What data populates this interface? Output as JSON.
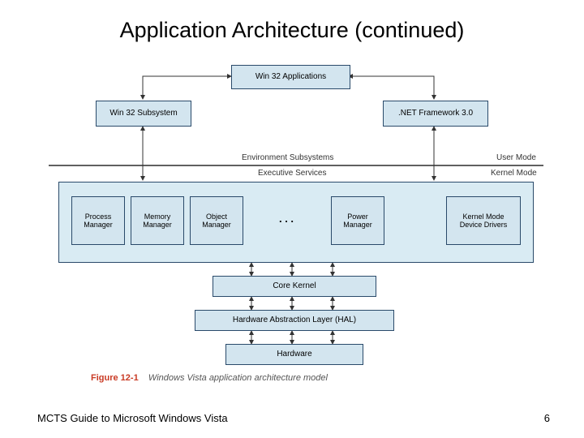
{
  "title": "Application Architecture (continued)",
  "boxes": {
    "win32_apps": "Win 32 Applications",
    "win32_sub": "Win 32 Subsystem",
    "netfx": ".NET Framework 3.0",
    "env_sub": "Environment Subsystems",
    "user_mode": "User Mode",
    "exec_svc": "Executive Services",
    "kernel_mode": "Kernel Mode",
    "proc_mgr": "Process\nManager",
    "mem_mgr": "Memory\nManager",
    "obj_mgr": "Object\nManager",
    "dots": ". . .",
    "power_mgr": "Power\nManager",
    "kmdd": "Kernel Mode\nDevice Drivers",
    "core_kernel": "Core Kernel",
    "hal": "Hardware Abstraction Layer (HAL)",
    "hardware": "Hardware"
  },
  "figure": {
    "number": "Figure 12-1",
    "text": "Windows Vista application architecture model"
  },
  "footer": {
    "left": "MCTS Guide to Microsoft Windows Vista",
    "page": "6"
  }
}
